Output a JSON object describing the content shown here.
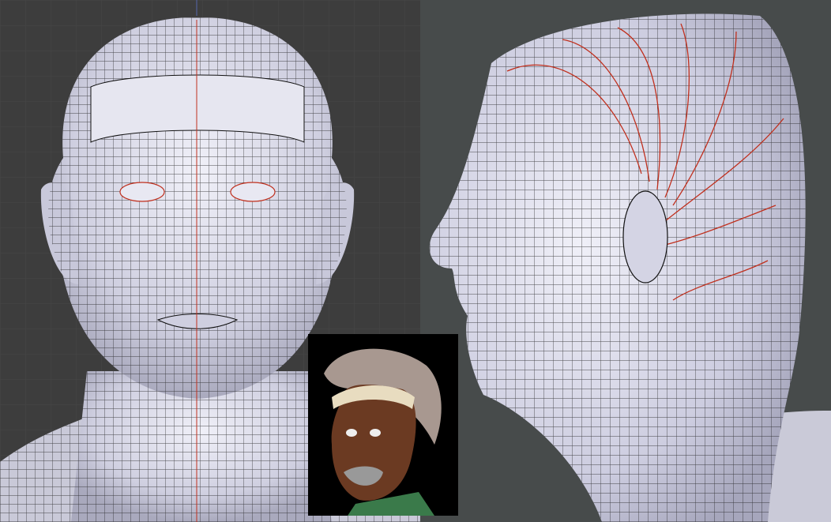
{
  "viewports": {
    "front": {
      "view": "front",
      "background": "#3d3d3d",
      "grid_color": "#474747",
      "axis_color": "#5566aa"
    },
    "side": {
      "view": "side",
      "background": "#474b4b"
    }
  },
  "mesh": {
    "surface_color": "#d6d6e6",
    "wire_color": "#111111",
    "seam_color": "#c0301e"
  },
  "render_preview": {
    "background": "#000000",
    "skin_color": "#6b3a22",
    "hair_color": "#a89890",
    "band_color": "#e8dcc0"
  }
}
